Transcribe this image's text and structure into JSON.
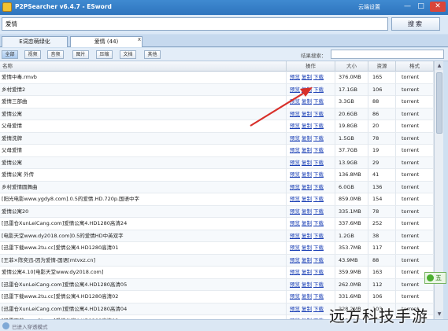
{
  "window": {
    "title": "P2PSearcher v6.4.7 - ESword",
    "cloud_settings": "云端设置",
    "minimize_glyph": "—",
    "maximize_glyph": "□",
    "close_glyph": "✕"
  },
  "search": {
    "value": "爱情",
    "button_label": "搜索"
  },
  "tabs": [
    {
      "label": "E词恋萌绿化"
    },
    {
      "label": "爱情 (44)"
    }
  ],
  "tab_close_glyph": "x",
  "filters": [
    "全部",
    "视频",
    "音频",
    "图片",
    "压缩",
    "文档",
    "其他"
  ],
  "result_search_label": "结果搜索：",
  "columns": {
    "name": "名称",
    "ops": "操作",
    "size": "大小",
    "sources": "资源",
    "format": "格式"
  },
  "ops_labels": {
    "preview": "预览",
    "copy": "复制",
    "download": "下载"
  },
  "rows": [
    {
      "name": "爱情中毒.rmvb",
      "size": "376.0MB",
      "sources": "165",
      "format": "torrent"
    },
    {
      "name": "乡村爱情2",
      "size": "17.1GB",
      "sources": "106",
      "format": "torrent"
    },
    {
      "name": "爱情三部曲",
      "size": "3.3GB",
      "sources": "88",
      "format": "torrent"
    },
    {
      "name": "爱情公寓",
      "size": "20.6GB",
      "sources": "86",
      "format": "torrent"
    },
    {
      "name": "父母爱情",
      "size": "19.8GB",
      "sources": "20",
      "format": "torrent"
    },
    {
      "name": "爱情洗牌",
      "size": "1.5GB",
      "sources": "78",
      "format": "torrent"
    },
    {
      "name": "父母爱情",
      "size": "37.7GB",
      "sources": "19",
      "format": "torrent"
    },
    {
      "name": "爱情公寓",
      "size": "13.9GB",
      "sources": "29",
      "format": "torrent"
    },
    {
      "name": "爱情公寓 外传",
      "size": "136.8MB",
      "sources": "41",
      "format": "torrent"
    },
    {
      "name": "乡村爱情圆舞曲",
      "size": "6.0GB",
      "sources": "136",
      "format": "torrent"
    },
    {
      "name": "[阳光电影www.ygdy8.com].0.5的爱情.HD.720p.国语中字",
      "size": "859.0MB",
      "sources": "154",
      "format": "torrent"
    },
    {
      "name": "爱情公寓20",
      "size": "335.1MB",
      "sources": "78",
      "format": "torrent"
    },
    {
      "name": "[迅雷仓XunLeiCang.com]爱情公寓4.HD1280高清24",
      "size": "337.6MB",
      "sources": "252",
      "format": "torrent"
    },
    {
      "name": "[电影天堂www.dy2018.com]0.5的爱情HD中英双字",
      "size": "1.2GB",
      "sources": "38",
      "format": "torrent"
    },
    {
      "name": "[迅雷下载www.2tu.cc]爱情公寓4.HD1280高清01",
      "size": "353.7MB",
      "sources": "117",
      "format": "torrent"
    },
    {
      "name": "[王菲×陈奕迅-因为爱情-国语[mtvxz.cn]",
      "size": "43.9MB",
      "sources": "88",
      "format": "torrent"
    },
    {
      "name": "爱情公寓4.10[电影天堂www.dy2018.com]",
      "size": "359.9MB",
      "sources": "163",
      "format": "torrent"
    },
    {
      "name": "[迅雷仓XunLeiCang.com]爱情公寓4.HD1280高清05",
      "size": "262.0MB",
      "sources": "112",
      "format": "torrent"
    },
    {
      "name": "[迅雷下载www.2tu.cc]爱情公寓4.HD1280高清02",
      "size": "331.6MB",
      "sources": "106",
      "format": "torrent"
    },
    {
      "name": "[迅雷仓XunLeiCang.com]爱情公寓4.HD1280高清04",
      "size": "328.2MB",
      "sources": "103",
      "format": "torrent"
    },
    {
      "name": "[迅雷下载www.2tu.cc]爱情公寓4.HD1280高清03",
      "size": "325.2MB",
      "sources": "97",
      "format": "torrent"
    }
  ],
  "side_badge": "五",
  "status_text": "已进入穿透模式",
  "watermark": "远方科技手游",
  "colors": {
    "titlebar": "#3079c4",
    "link": "#1a3fb5",
    "arrow": "#d8302a"
  }
}
